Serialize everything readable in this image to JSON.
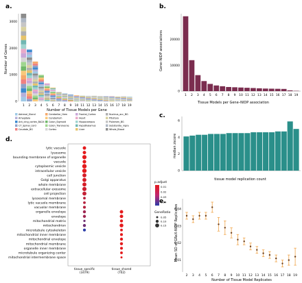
{
  "chart_data": [
    {
      "panel": "a.",
      "type": "bar",
      "stacked": true,
      "xlabel": "Number of Tissue Models per Gene",
      "ylabel": "Number of Genes",
      "yticks": [
        0,
        1000,
        2000,
        3000
      ],
      "categories": [
        "1",
        "2",
        "3",
        "4",
        "5",
        "6",
        "7",
        "8",
        "9",
        "10",
        "11",
        "12",
        "13",
        "14",
        "15",
        "16",
        "17",
        "18",
        "19"
      ],
      "values": [
        3300,
        1950,
        1500,
        1000,
        680,
        520,
        360,
        300,
        260,
        230,
        220,
        210,
        210,
        200,
        200,
        190,
        180,
        190,
        175
      ],
      "ylim": [
        0,
        3300
      ],
      "legend": [
        "Adrenal_Gland",
        "Amygdala",
        "Ant_cing_cortex_BA24",
        "CT_Spinal_cord",
        "Caudate_BG",
        "Cerebellar_Hem",
        "Cerebellum",
        "Colon_Sigmoid",
        "Colon_Transverse",
        "Cortex",
        "Frontal_Cortex",
        "Heart",
        "Hippocampus",
        "Hypothalamus",
        "Liver",
        "Nucleus_acc_BG",
        "Pituitary",
        "Putamen_BG",
        "Substantia_nigra",
        "Whole_Blood"
      ],
      "legend_colors": [
        "#9ec9e6",
        "#b5b0d9",
        "#3c8ad0",
        "#8fa0c8",
        "#f08080",
        "#f5a86a",
        "#f8c97a",
        "#72b86a",
        "#9fd68f",
        "#d5d5d5",
        "#c9a6d8",
        "#e8a9c9",
        "#a0d4d0",
        "#6fb7b3",
        "#e6c36a",
        "#b0b0b0",
        "#d9d2a0",
        "#c6c6c6",
        "#aeb7c4",
        "#8c8c8c"
      ]
    },
    {
      "panel": "b.",
      "type": "bar",
      "xlabel": "Tissue Models per Gene–NIDP association",
      "ylabel": "Gene–NIDP associations",
      "yticks": [
        0,
        10000,
        20000
      ],
      "categories": [
        "1",
        "2",
        "3",
        "4",
        "5",
        "6",
        "7",
        "8",
        "9",
        "10",
        "11",
        "12",
        "13",
        "14",
        "15",
        "16",
        "17",
        "18",
        "19"
      ],
      "values": [
        29000,
        12000,
        6200,
        3900,
        2800,
        2200,
        1900,
        1600,
        1500,
        1400,
        1300,
        1200,
        1100,
        1000,
        950,
        900,
        850,
        300,
        120
      ],
      "ylim": [
        0,
        30000
      ],
      "color": "#7b2d4f"
    },
    {
      "panel": "c.",
      "type": "bar",
      "xlabel": "tissue model replication count",
      "ylabel": "median zscore",
      "yticks": [
        0,
        2,
        4,
        6
      ],
      "categories": [
        "1",
        "2",
        "3",
        "4",
        "5",
        "6",
        "7",
        "8",
        "9",
        "10",
        "11",
        "12",
        "13",
        "14",
        "15",
        "16",
        "17",
        "18",
        "19"
      ],
      "values": [
        4.1,
        4.2,
        4.3,
        4.3,
        4.4,
        4.4,
        4.4,
        4.5,
        4.5,
        4.5,
        4.5,
        4.6,
        4.6,
        4.6,
        4.6,
        4.7,
        4.7,
        5.9,
        5.0
      ],
      "ylim": [
        0,
        6
      ],
      "color": "#2a8f8a"
    },
    {
      "panel": "d.",
      "type": "scatter",
      "categories_x": [
        "tissue_specific\n(3479)",
        "tissue_shared\n(702)"
      ],
      "categories_x_lines": [
        [
          "tissue_specific",
          "(3479)"
        ],
        [
          "tissue_shared",
          "(702)"
        ]
      ],
      "terms": [
        "lytic vacuole",
        "lysosome",
        "bounding membrane of organelle",
        "vacuole",
        "cytoplasmic vesicle",
        "intracellular vesicle",
        "cell junction",
        "Golgi apparatus",
        "whole membrane",
        "extracellular exosome",
        "cell projection",
        "lysosomal membrane",
        "lytic vacuole membrane",
        "vacuolar membrane",
        "organelle envelope",
        "envelope",
        "mitochondrial matrix",
        "mitochondrion",
        "microtubule cytoskeleton",
        "mitochondrial inner membrane",
        "mitochondrial envelope",
        "mitochondrial membrane",
        "organelle inner membrane",
        "microtubule organizing center",
        "mitochondrial intermembrane space"
      ],
      "points": [
        {
          "term": "lytic vacuole",
          "group": 0,
          "p_adjust": 0.005,
          "gene_ratio": 0.12
        },
        {
          "term": "lysosome",
          "group": 0,
          "p_adjust": 0.005,
          "gene_ratio": 0.12
        },
        {
          "term": "bounding membrane of organelle",
          "group": 0,
          "p_adjust": 0.005,
          "gene_ratio": 0.16
        },
        {
          "term": "vacuole",
          "group": 0,
          "p_adjust": 0.005,
          "gene_ratio": 0.13
        },
        {
          "term": "cytoplasmic vesicle",
          "group": 0,
          "p_adjust": 0.005,
          "gene_ratio": 0.17
        },
        {
          "term": "intracellular vesicle",
          "group": 0,
          "p_adjust": 0.005,
          "gene_ratio": 0.17
        },
        {
          "term": "cell junction",
          "group": 0,
          "p_adjust": 0.008,
          "gene_ratio": 0.15
        },
        {
          "term": "Golgi apparatus",
          "group": 0,
          "p_adjust": 0.008,
          "gene_ratio": 0.15
        },
        {
          "term": "whole membrane",
          "group": 0,
          "p_adjust": 0.008,
          "gene_ratio": 0.15
        },
        {
          "term": "extracellular exosome",
          "group": 0,
          "p_adjust": 0.01,
          "gene_ratio": 0.16
        },
        {
          "term": "cell projection",
          "group": 0,
          "p_adjust": 0.012,
          "gene_ratio": 0.15
        },
        {
          "term": "lysosomal membrane",
          "group": 0,
          "p_adjust": 0.015,
          "gene_ratio": 0.08
        },
        {
          "term": "lytic vacuole membrane",
          "group": 0,
          "p_adjust": 0.015,
          "gene_ratio": 0.08
        },
        {
          "term": "vacuolar membrane",
          "group": 0,
          "p_adjust": 0.015,
          "gene_ratio": 0.09
        },
        {
          "term": "organelle envelope",
          "group": 0,
          "p_adjust": 0.02,
          "gene_ratio": 0.1
        },
        {
          "term": "envelope",
          "group": 0,
          "p_adjust": 0.02,
          "gene_ratio": 0.1
        },
        {
          "term": "mitochondrial matrix",
          "group": 0,
          "p_adjust": 0.03,
          "gene_ratio": 0.06
        },
        {
          "term": "mitochondrion",
          "group": 0,
          "p_adjust": 0.03,
          "gene_ratio": 0.1
        },
        {
          "term": "microtubule cytoskeleton",
          "group": 0,
          "p_adjust": 0.045,
          "gene_ratio": 0.09
        },
        {
          "term": "organelle envelope",
          "group": 1,
          "p_adjust": 0.005,
          "gene_ratio": 0.12
        },
        {
          "term": "envelope",
          "group": 1,
          "p_adjust": 0.005,
          "gene_ratio": 0.12
        },
        {
          "term": "mitochondrial matrix",
          "group": 1,
          "p_adjust": 0.005,
          "gene_ratio": 0.1
        },
        {
          "term": "mitochondrion",
          "group": 1,
          "p_adjust": 0.005,
          "gene_ratio": 0.14
        },
        {
          "term": "microtubule cytoskeleton",
          "group": 1,
          "p_adjust": 0.005,
          "gene_ratio": 0.08
        },
        {
          "term": "mitochondrial inner membrane",
          "group": 1,
          "p_adjust": 0.005,
          "gene_ratio": 0.09
        },
        {
          "term": "mitochondrial envelope",
          "group": 1,
          "p_adjust": 0.005,
          "gene_ratio": 0.1
        },
        {
          "term": "mitochondrial membrane",
          "group": 1,
          "p_adjust": 0.005,
          "gene_ratio": 0.1
        },
        {
          "term": "organelle inner membrane",
          "group": 1,
          "p_adjust": 0.005,
          "gene_ratio": 0.09
        },
        {
          "term": "microtubule organizing center",
          "group": 1,
          "p_adjust": 0.005,
          "gene_ratio": 0.08
        },
        {
          "term": "mitochondrial intermembrane space",
          "group": 1,
          "p_adjust": 0.005,
          "gene_ratio": 0.05
        }
      ],
      "color_legend_title": "p.adjust",
      "color_legend_ticks": [
        "0.01",
        "0.02",
        "0.03",
        "0.04"
      ],
      "size_legend_title": "GeneRatio",
      "size_legend_values": [
        "0.05",
        "0.10",
        "0.15"
      ],
      "colors": {
        "low": "#e41a1c",
        "high": "#2b3ca8"
      }
    },
    {
      "panel": "e.",
      "type": "scatter",
      "with_error_bars": true,
      "xlabel": "Number of Tissue Model Replicates",
      "ylabel": "Mean SD of GReX-NIDP Replicates",
      "yticks": [
        0.01,
        0.02,
        0.03,
        0.04
      ],
      "ylim": [
        0.003,
        0.046
      ],
      "x": [
        2,
        3,
        4,
        5,
        6,
        7,
        8,
        9,
        10,
        11,
        12,
        13,
        14,
        15,
        16,
        17,
        18,
        19
      ],
      "y": [
        0.036,
        0.034,
        0.036,
        0.036,
        0.041,
        0.031,
        0.029,
        0.026,
        0.022,
        0.021,
        0.018,
        0.016,
        0.014,
        0.013,
        0.011,
        0.008,
        0.01,
        0.012
      ],
      "err": [
        0.002,
        0.002,
        0.002,
        0.002,
        0.003,
        0.004,
        0.004,
        0.003,
        0.003,
        0.002,
        0.002,
        0.002,
        0.002,
        0.002,
        0.002,
        0.002,
        0.003,
        0.005
      ],
      "point_color": "#6b3f1e",
      "errorbar_color": "#f0a54a"
    }
  ]
}
